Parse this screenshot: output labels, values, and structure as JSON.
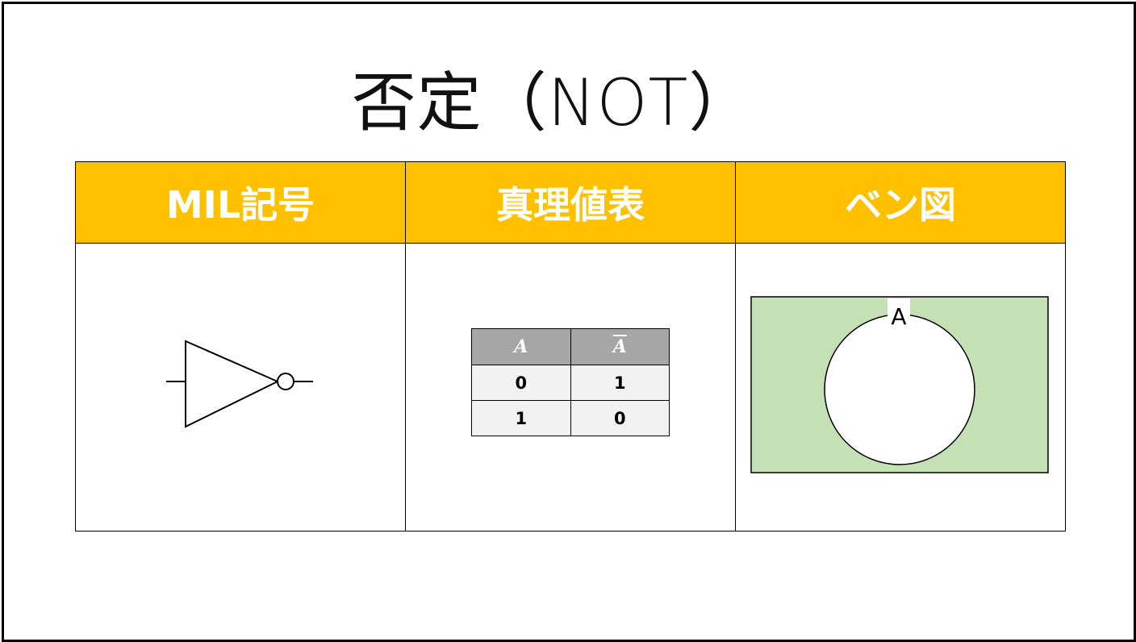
{
  "slide": {
    "title": "否定（NOT）"
  },
  "table": {
    "headers": {
      "mil": "MIL記号",
      "truth": "真理値表",
      "venn": "ベン図"
    }
  },
  "truth_table": {
    "headers": [
      "A",
      "A"
    ],
    "rows": [
      [
        "0",
        "1"
      ],
      [
        "1",
        "0"
      ]
    ]
  },
  "venn": {
    "set_label": "A",
    "colors": {
      "universe_fill": "#c5e0b4",
      "circle_fill": "#ffffff"
    }
  },
  "colors": {
    "header_bg": "#ffc000",
    "truth_header_bg": "#a6a6a6",
    "truth_cell_bg": "#f2f2f2"
  }
}
